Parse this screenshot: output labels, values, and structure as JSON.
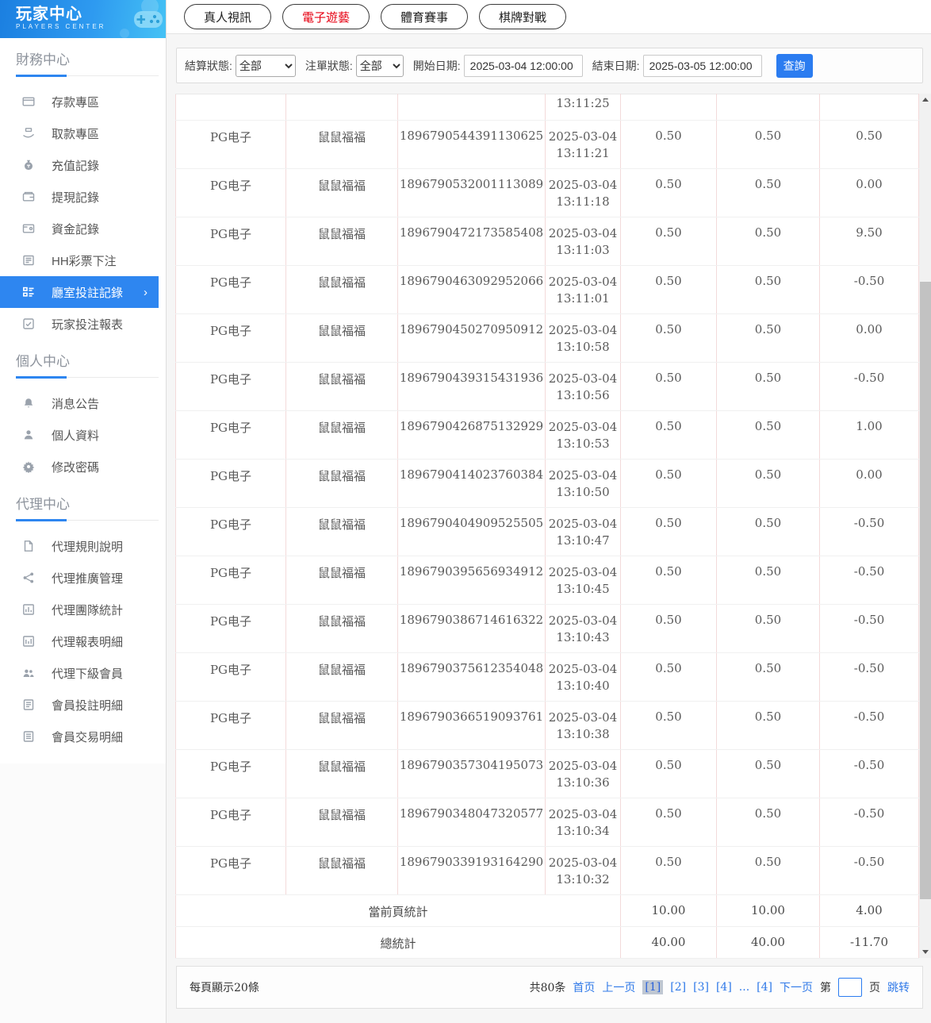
{
  "sidebar": {
    "logo_title": "玩家中心",
    "logo_subtitle": "PLAYERS CENTER",
    "section_finance": "財務中心",
    "section_personal": "個人中心",
    "section_agent": "代理中心",
    "items": {
      "deposit": "存款專區",
      "withdraw": "取款專區",
      "recharge_record": "充值記錄",
      "withdraw_record": "提現記錄",
      "funds_record": "資金記錄",
      "hh_lottery": "HH彩票下注",
      "hall_bet_record": "廳室投註記錄",
      "player_bet_report": "玩家投注報表",
      "messages": "消息公告",
      "profile": "個人資料",
      "change_password": "修改密碼",
      "agent_rules": "代理規則說明",
      "agent_promo": "代理推廣管理",
      "agent_team_stats": "代理團隊統計",
      "agent_report_detail": "代理報表明細",
      "agent_sub_members": "代理下級會員",
      "member_bet_detail": "會員投註明細",
      "member_trade_detail": "會員交易明細"
    }
  },
  "tabs": {
    "live": "真人視訊",
    "slots": "電子遊藝",
    "sports": "體育賽事",
    "board": "棋牌對戰"
  },
  "filters": {
    "settle_status_label": "結算狀態:",
    "settle_status_value": "全部",
    "order_status_label": "注單狀態:",
    "order_status_value": "全部",
    "start_label": "開始日期:",
    "start_value": "2025-03-04 12:00:00",
    "end_label": "結束日期:",
    "end_value": "2025-03-05 12:00:00",
    "query_label": "查詢"
  },
  "table": {
    "partial_row_time": "13:11:25",
    "rows": [
      {
        "provider": "PG电子",
        "game": "鼠鼠福福",
        "order_id": "1896790544391130625",
        "date": "2025-03-04",
        "time": "13:11:21",
        "bet": "0.50",
        "valid": "0.50",
        "win": "0.50"
      },
      {
        "provider": "PG电子",
        "game": "鼠鼠福福",
        "order_id": "1896790532001113089",
        "date": "2025-03-04",
        "time": "13:11:18",
        "bet": "0.50",
        "valid": "0.50",
        "win": "0.00"
      },
      {
        "provider": "PG电子",
        "game": "鼠鼠福福",
        "order_id": "1896790472173585408",
        "date": "2025-03-04",
        "time": "13:11:03",
        "bet": "0.50",
        "valid": "0.50",
        "win": "9.50"
      },
      {
        "provider": "PG电子",
        "game": "鼠鼠福福",
        "order_id": "1896790463092952066",
        "date": "2025-03-04",
        "time": "13:11:01",
        "bet": "0.50",
        "valid": "0.50",
        "win": "-0.50"
      },
      {
        "provider": "PG电子",
        "game": "鼠鼠福福",
        "order_id": "1896790450270950912",
        "date": "2025-03-04",
        "time": "13:10:58",
        "bet": "0.50",
        "valid": "0.50",
        "win": "0.00"
      },
      {
        "provider": "PG电子",
        "game": "鼠鼠福福",
        "order_id": "1896790439315431936",
        "date": "2025-03-04",
        "time": "13:10:56",
        "bet": "0.50",
        "valid": "0.50",
        "win": "-0.50"
      },
      {
        "provider": "PG电子",
        "game": "鼠鼠福福",
        "order_id": "1896790426875132929",
        "date": "2025-03-04",
        "time": "13:10:53",
        "bet": "0.50",
        "valid": "0.50",
        "win": "1.00"
      },
      {
        "provider": "PG电子",
        "game": "鼠鼠福福",
        "order_id": "1896790414023760384",
        "date": "2025-03-04",
        "time": "13:10:50",
        "bet": "0.50",
        "valid": "0.50",
        "win": "0.00"
      },
      {
        "provider": "PG电子",
        "game": "鼠鼠福福",
        "order_id": "1896790404909525505",
        "date": "2025-03-04",
        "time": "13:10:47",
        "bet": "0.50",
        "valid": "0.50",
        "win": "-0.50"
      },
      {
        "provider": "PG电子",
        "game": "鼠鼠福福",
        "order_id": "1896790395656934912",
        "date": "2025-03-04",
        "time": "13:10:45",
        "bet": "0.50",
        "valid": "0.50",
        "win": "-0.50"
      },
      {
        "provider": "PG电子",
        "game": "鼠鼠福福",
        "order_id": "1896790386714616322",
        "date": "2025-03-04",
        "time": "13:10:43",
        "bet": "0.50",
        "valid": "0.50",
        "win": "-0.50"
      },
      {
        "provider": "PG电子",
        "game": "鼠鼠福福",
        "order_id": "1896790375612354048",
        "date": "2025-03-04",
        "time": "13:10:40",
        "bet": "0.50",
        "valid": "0.50",
        "win": "-0.50"
      },
      {
        "provider": "PG电子",
        "game": "鼠鼠福福",
        "order_id": "1896790366519093761",
        "date": "2025-03-04",
        "time": "13:10:38",
        "bet": "0.50",
        "valid": "0.50",
        "win": "-0.50"
      },
      {
        "provider": "PG电子",
        "game": "鼠鼠福福",
        "order_id": "1896790357304195073",
        "date": "2025-03-04",
        "time": "13:10:36",
        "bet": "0.50",
        "valid": "0.50",
        "win": "-0.50"
      },
      {
        "provider": "PG电子",
        "game": "鼠鼠福福",
        "order_id": "1896790348047320577",
        "date": "2025-03-04",
        "time": "13:10:34",
        "bet": "0.50",
        "valid": "0.50",
        "win": "-0.50"
      },
      {
        "provider": "PG电子",
        "game": "鼠鼠福福",
        "order_id": "1896790339193164290",
        "date": "2025-03-04",
        "time": "13:10:32",
        "bet": "0.50",
        "valid": "0.50",
        "win": "-0.50"
      }
    ],
    "page_summary": {
      "label": "當前頁統計",
      "bet": "10.00",
      "valid": "10.00",
      "win": "4.00"
    },
    "total_summary": {
      "label": "總統計",
      "bet": "40.00",
      "valid": "40.00",
      "win": "-11.70"
    }
  },
  "pagination": {
    "per_page": "每頁顯示20條",
    "total_count": "共80条",
    "first_label": "首页",
    "prev_label": "上一页",
    "page1": "[1]",
    "page2": "[2]",
    "page3": "[3]",
    "page4": "[4]",
    "ellipsis": "...",
    "last_page": "[4]",
    "next_label": "下一页",
    "jump_pre": "第",
    "jump_post": "页",
    "jump_go": "跳转"
  },
  "colors": {
    "accent_blue": "#2e86f0",
    "active_tab_red": "#e60012",
    "link_blue": "#2f79e8",
    "grid_border_pink": "#f3dada"
  }
}
